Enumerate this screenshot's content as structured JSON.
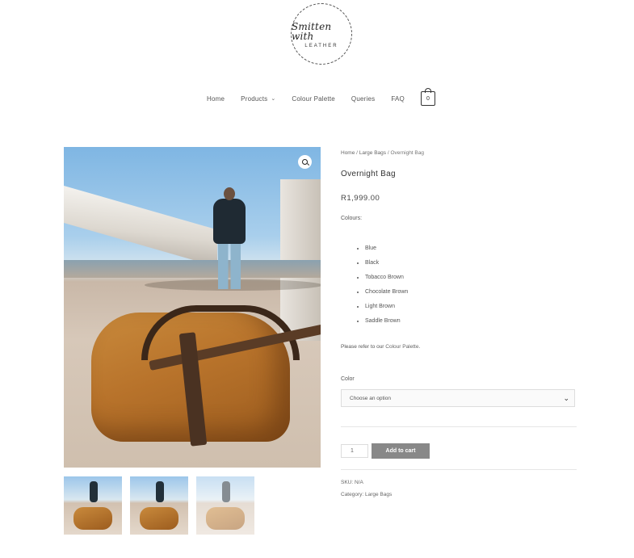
{
  "logo": {
    "script": "Smitten with",
    "sub": "LEATHER"
  },
  "nav": {
    "items": [
      {
        "label": "Home"
      },
      {
        "label": "Products",
        "has_dropdown": true
      },
      {
        "label": "Colour Palette"
      },
      {
        "label": "Queries"
      },
      {
        "label": "FAQ"
      }
    ],
    "cart_count": "0"
  },
  "breadcrumb": {
    "home": "Home",
    "sep1": " / ",
    "category": "Large Bags",
    "sep2": " / ",
    "current": "Overnight Bag"
  },
  "product": {
    "title": "Overnight Bag",
    "price": "R1,999.00",
    "colours_label": "Colours:",
    "colours": [
      "Blue",
      "Black",
      "Tobacco Brown",
      "Chocolate Brown",
      "Light Brown",
      "Saddle Brown"
    ],
    "palette_note_prefix": "Please refer to our ",
    "palette_note_link": "Colour Palette",
    "palette_note_suffix": ".",
    "color_label": "Color",
    "select_placeholder": "Choose an option",
    "quantity": "1",
    "add_to_cart": "Add to cart",
    "sku_label": "SKU: ",
    "sku_value": "N/A",
    "category_label": "Category: ",
    "category_value": "Large Bags"
  },
  "icons": {
    "zoom": "magnifier-icon",
    "cart": "shopping-bag-icon",
    "dropdown": "chevron-down-icon"
  }
}
